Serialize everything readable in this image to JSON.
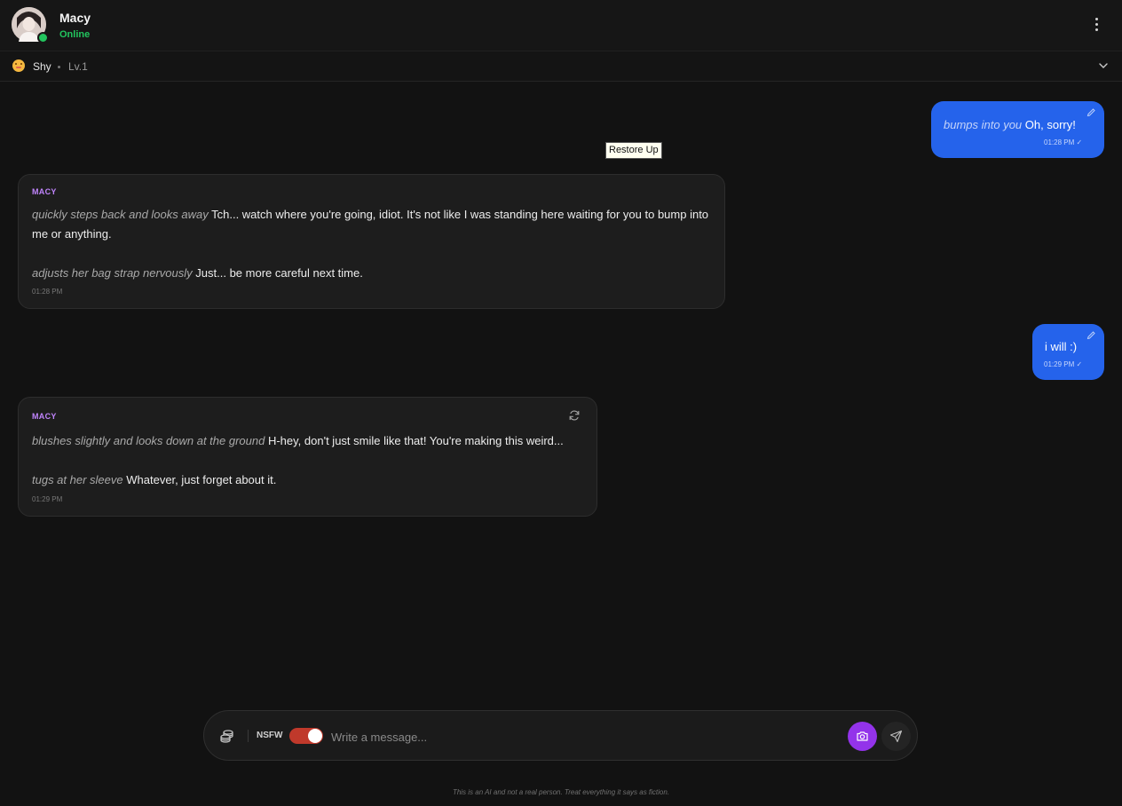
{
  "header": {
    "name": "Macy",
    "status": "Online",
    "menu_icon": "kebab-menu-icon"
  },
  "mood": {
    "emoji_icon": "flushed-face-icon",
    "label": "Shy",
    "level": "Lv.1",
    "expand_icon": "chevron-down-icon"
  },
  "tooltip": "Restore Up",
  "messages": [
    {
      "sender": "user",
      "action": "bumps into you",
      "text": "Oh, sorry!",
      "time": "01:28 PM"
    },
    {
      "sender": "ai",
      "name": "MACY",
      "paragraphs": [
        {
          "action": "quickly steps back and looks away",
          "text": "Tch... watch where you're going, idiot. It's not like I was standing here waiting for you to bump into me or anything."
        },
        {
          "action": "adjusts her bag strap nervously",
          "text": "Just... be more careful next time."
        }
      ],
      "time": "01:28 PM"
    },
    {
      "sender": "user",
      "text": "i will :)",
      "time": "01:29 PM"
    },
    {
      "sender": "ai",
      "name": "MACY",
      "paragraphs": [
        {
          "action": "blushes slightly and looks down at the ground",
          "text": "H-hey, don't just smile like that! You're making this weird..."
        },
        {
          "action": "tugs at her sleeve",
          "text": "Whatever, just forget about it."
        }
      ],
      "time": "01:29 PM"
    }
  ],
  "composer": {
    "nsfw_label": "NSFW",
    "nsfw_enabled": true,
    "placeholder": "Write a message...",
    "value": ""
  },
  "colors": {
    "accent_user": "#2563eb",
    "accent_ai_name": "#c084fc",
    "online": "#22c55e",
    "camera": "#9333ea",
    "toggle_on": "#c0392b"
  },
  "disclaimer": "This is an AI and not a real person. Treat everything it says as fiction."
}
